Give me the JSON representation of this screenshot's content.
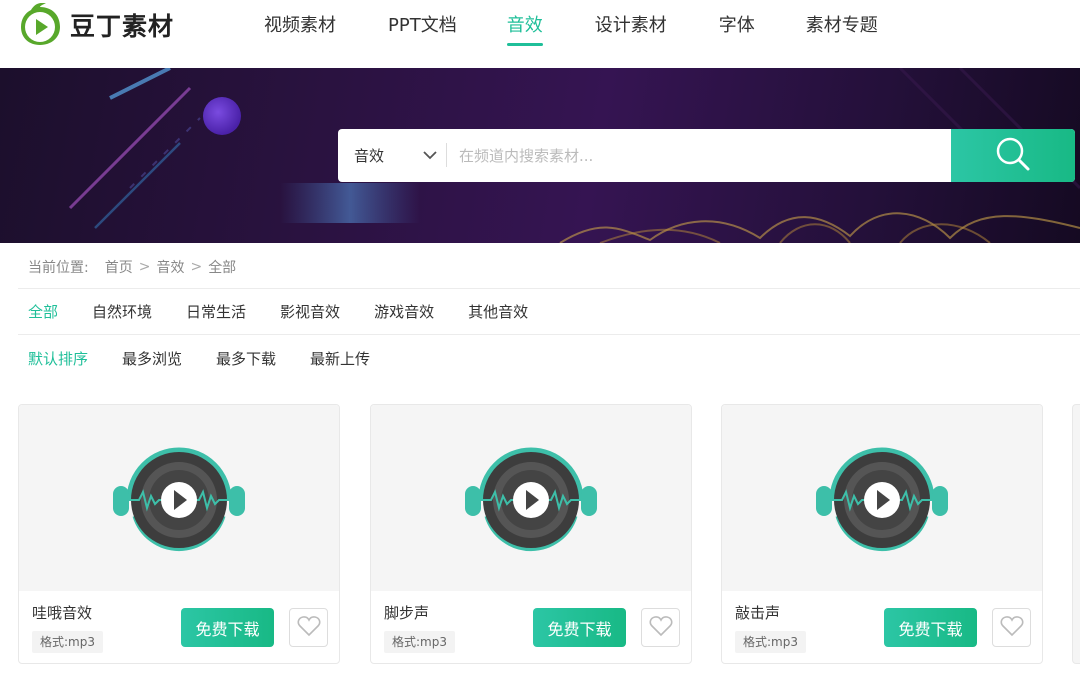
{
  "brand": {
    "name": "豆丁素材",
    "accent": "#1fbf99",
    "logo_color": "#58a82b"
  },
  "nav": {
    "items": [
      {
        "label": "视频素材",
        "active": false
      },
      {
        "label": "PPT文档",
        "active": false
      },
      {
        "label": "音效",
        "active": true
      },
      {
        "label": "设计素材",
        "active": false
      },
      {
        "label": "字体",
        "active": false
      },
      {
        "label": "素材专题",
        "active": false
      }
    ]
  },
  "search": {
    "category": "音效",
    "placeholder": "在频道内搜索素材...",
    "value": "",
    "icon": "search-icon"
  },
  "breadcrumb": {
    "label": "当前位置:",
    "items": [
      "首页",
      "音效",
      "全部"
    ],
    "separator": ">"
  },
  "filters": {
    "categories": [
      {
        "label": "全部",
        "active": true
      },
      {
        "label": "自然环境",
        "active": false
      },
      {
        "label": "日常生活",
        "active": false
      },
      {
        "label": "影视音效",
        "active": false
      },
      {
        "label": "游戏音效",
        "active": false
      },
      {
        "label": "其他音效",
        "active": false
      }
    ],
    "sort": [
      {
        "label": "默认排序",
        "active": true
      },
      {
        "label": "最多浏览",
        "active": false
      },
      {
        "label": "最多下载",
        "active": false
      },
      {
        "label": "最新上传",
        "active": false
      }
    ]
  },
  "cards": [
    {
      "title": "哇哦音效",
      "format_label": "格式:",
      "format_value": "mp3",
      "download_label": "免费下载"
    },
    {
      "title": "脚步声",
      "format_label": "格式:",
      "format_value": "mp3",
      "download_label": "免费下载"
    },
    {
      "title": "敲击声",
      "format_label": "格式:",
      "format_value": "mp3",
      "download_label": "免费下载"
    }
  ]
}
